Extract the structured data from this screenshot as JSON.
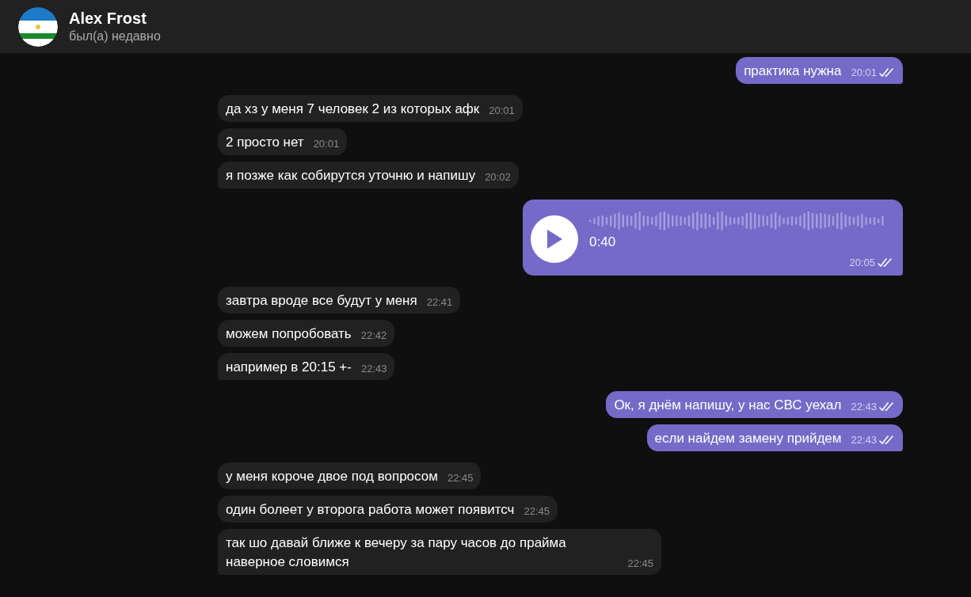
{
  "header": {
    "name": "Alex Frost",
    "status": "был(а) недавно"
  },
  "groups": [
    {
      "outgoing": true,
      "messages": [
        {
          "kind": "text",
          "text": "практика нужна",
          "time": "20:01",
          "read": true
        }
      ]
    },
    {
      "outgoing": false,
      "messages": [
        {
          "kind": "text",
          "text": "да хз у меня 7 человек 2 из которых афк",
          "time": "20:01"
        },
        {
          "kind": "text",
          "text": "2 просто нет",
          "time": "20:01"
        },
        {
          "kind": "text",
          "text": "я позже как собирутся уточню и напишу",
          "time": "20:02"
        }
      ]
    },
    {
      "outgoing": true,
      "messages": [
        {
          "kind": "voice",
          "duration": "0:40",
          "time": "20:05",
          "read": true
        }
      ]
    },
    {
      "outgoing": false,
      "messages": [
        {
          "kind": "text",
          "text": "завтра вроде все будут у меня",
          "time": "22:41"
        },
        {
          "kind": "text",
          "text": "можем попробовать",
          "time": "22:42"
        },
        {
          "kind": "text",
          "text": "например в 20:15 +-",
          "time": "22:43"
        }
      ]
    },
    {
      "outgoing": true,
      "messages": [
        {
          "kind": "text",
          "text": "Ок, я днём напишу, у нас СВС уехал",
          "time": "22:43",
          "read": true
        },
        {
          "kind": "text",
          "text": "если найдем замену прийдем",
          "time": "22:43",
          "read": true
        }
      ]
    },
    {
      "outgoing": false,
      "messages": [
        {
          "kind": "text",
          "text": "у меня короче двое под вопросом",
          "time": "22:45"
        },
        {
          "kind": "text",
          "text": "один болеет у второга работа может появитсч",
          "time": "22:45"
        },
        {
          "kind": "text",
          "text": "так шо давай ближе к вечеру за пару часов до прайма наверное словимся",
          "time": "22:45"
        }
      ]
    }
  ]
}
